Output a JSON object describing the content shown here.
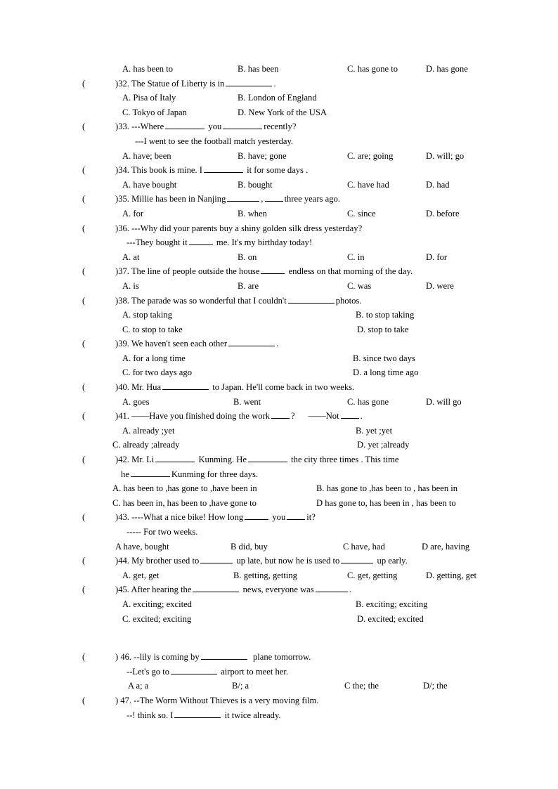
{
  "document": {
    "type": "english-grammar-multiple-choice-worksheet",
    "font_color": "#000000",
    "background": "#ffffff"
  },
  "paren_open": "(",
  "paren_close": ")",
  "q31_options": {
    "a": "A. has been to",
    "b": "B. has been",
    "c": "C. has gone to",
    "d": "D. has gone"
  },
  "q32": {
    "number": ")32.",
    "stem_before": "The Statue of Liberty is in",
    "stem_after": ".",
    "a": "A. Pisa of Italy",
    "b": "B. London of England",
    "c": "C. Tokyo of Japan",
    "d": "D. New York of the USA"
  },
  "q33": {
    "number": ")33.",
    "stem_p1": "---Where",
    "stem_p2": "you",
    "stem_p3": "recently?",
    "reply": "---I went to see the football match yesterday.",
    "a": "A. have; been",
    "b": "B. have; gone",
    "c": "C. are; going",
    "d": "D. will; go"
  },
  "q34": {
    "number": ")34.",
    "stem_p1": "This book is mine. I",
    "stem_p2": "it for some days .",
    "a": "A. have bought",
    "b": "B. bought",
    "c": "C. have had",
    "d": "D. had"
  },
  "q35": {
    "number": ")35.",
    "stem_p1": "Millie has been in Nanjing",
    "stem_p2": ",",
    "stem_p3": "three years ago.",
    "a": "A. for",
    "b": "B. when",
    "c": "C. since",
    "d": "D. before"
  },
  "q36": {
    "number": ")36.",
    "stem": "---Why did your parents buy a shiny golden silk dress yesterday?",
    "reply_p1": "---They bought it",
    "reply_p2": "me. It's my birthday today!",
    "a": "A. at",
    "b": "B. on",
    "c": "C. in",
    "d": "D. for"
  },
  "q37": {
    "number": ")37.",
    "stem_p1": "The line of people outside the house",
    "stem_p2": "endless on that morning of the day.",
    "a": "A. is",
    "b": "B. are",
    "c": "C. was",
    "d": "D. were"
  },
  "q38": {
    "number": ")38.",
    "stem_p1": "The parade was so wonderful that I couldn't",
    "stem_p2": "photos.",
    "a": "A. stop taking",
    "b": "B. to stop taking",
    "c": "C. to stop to take",
    "d": "D. stop to take"
  },
  "q39": {
    "number": ")39.",
    "stem_p1": "We haven't seen each other",
    "stem_p2": ".",
    "a": "A. for a long time",
    "b": "B. since two days",
    "c": "C. for two days ago",
    "d": "D. a long time ago"
  },
  "q40": {
    "number": ")40.",
    "stem_p1": "Mr. Hua",
    "stem_p2": "to Japan. He'll come back in two weeks.",
    "a": "A. goes",
    "b": "B. went",
    "c": "C. has gone",
    "d": "D. will go"
  },
  "q41": {
    "number": ")41.",
    "stem_p1": "——Have you finished doing the work",
    "stem_p2": "?",
    "stem_p3": "——Not",
    "stem_p4": ".",
    "a": "A. already ;yet",
    "b": "B. yet ;yet",
    "c": "C. already ;already",
    "d": "D. yet ;already"
  },
  "q42": {
    "number": ")42.",
    "stem_p1": "Mr. Li",
    "stem_p2": "Kunming. He",
    "stem_p3": "the city three times . This time",
    "line2_p1": "he",
    "line2_p2": "Kunming for three days.",
    "a": "A. has been to ,has gone to ,have been in",
    "b": "B. has gone to ,has been to , has been in",
    "c": "C. has been in, has been to ,have gone to",
    "d": "D has gone to, has been in , has been to"
  },
  "q43": {
    "number": ")43.",
    "stem_p1": "----What a nice bike! How long",
    "stem_p2": "you",
    "stem_p3": "it?",
    "reply": "----- For two weeks.",
    "a": "A have, bought",
    "b": "B did, buy",
    "c": "C have, had",
    "d": "D are, having"
  },
  "q44": {
    "number": ")44.",
    "stem_p1": "My brother used to",
    "stem_p2": "up late, but now he is used to",
    "stem_p3": "up early.",
    "a": "A. get, get",
    "b": "B. getting, getting",
    "c": "C. get, getting",
    "d": "D. getting, get"
  },
  "q45": {
    "number": ")45.",
    "stem_p1": "After hearing the",
    "stem_p2": "news, everyone was",
    "stem_p3": ".",
    "a": "A. exciting; excited",
    "b": "B. exciting; exciting",
    "c": "C. excited; exciting",
    "d": "D. excited; excited"
  },
  "q46": {
    "number": ") 46.",
    "stem_p1": "--lily is coming by",
    "stem_p2": "plane tomorrow.",
    "line2_p1": "--Let's go to",
    "line2_p2": "airport to meet her.",
    "a": "A a; a",
    "b": "B/; a",
    "c": "C the; the",
    "d": "D/; the"
  },
  "q47": {
    "number": ") 47.",
    "stem": "--The Worm Without Thieves is a very moving film.",
    "line2_p1": "--! think so. I",
    "line2_p2": "it twice already."
  }
}
